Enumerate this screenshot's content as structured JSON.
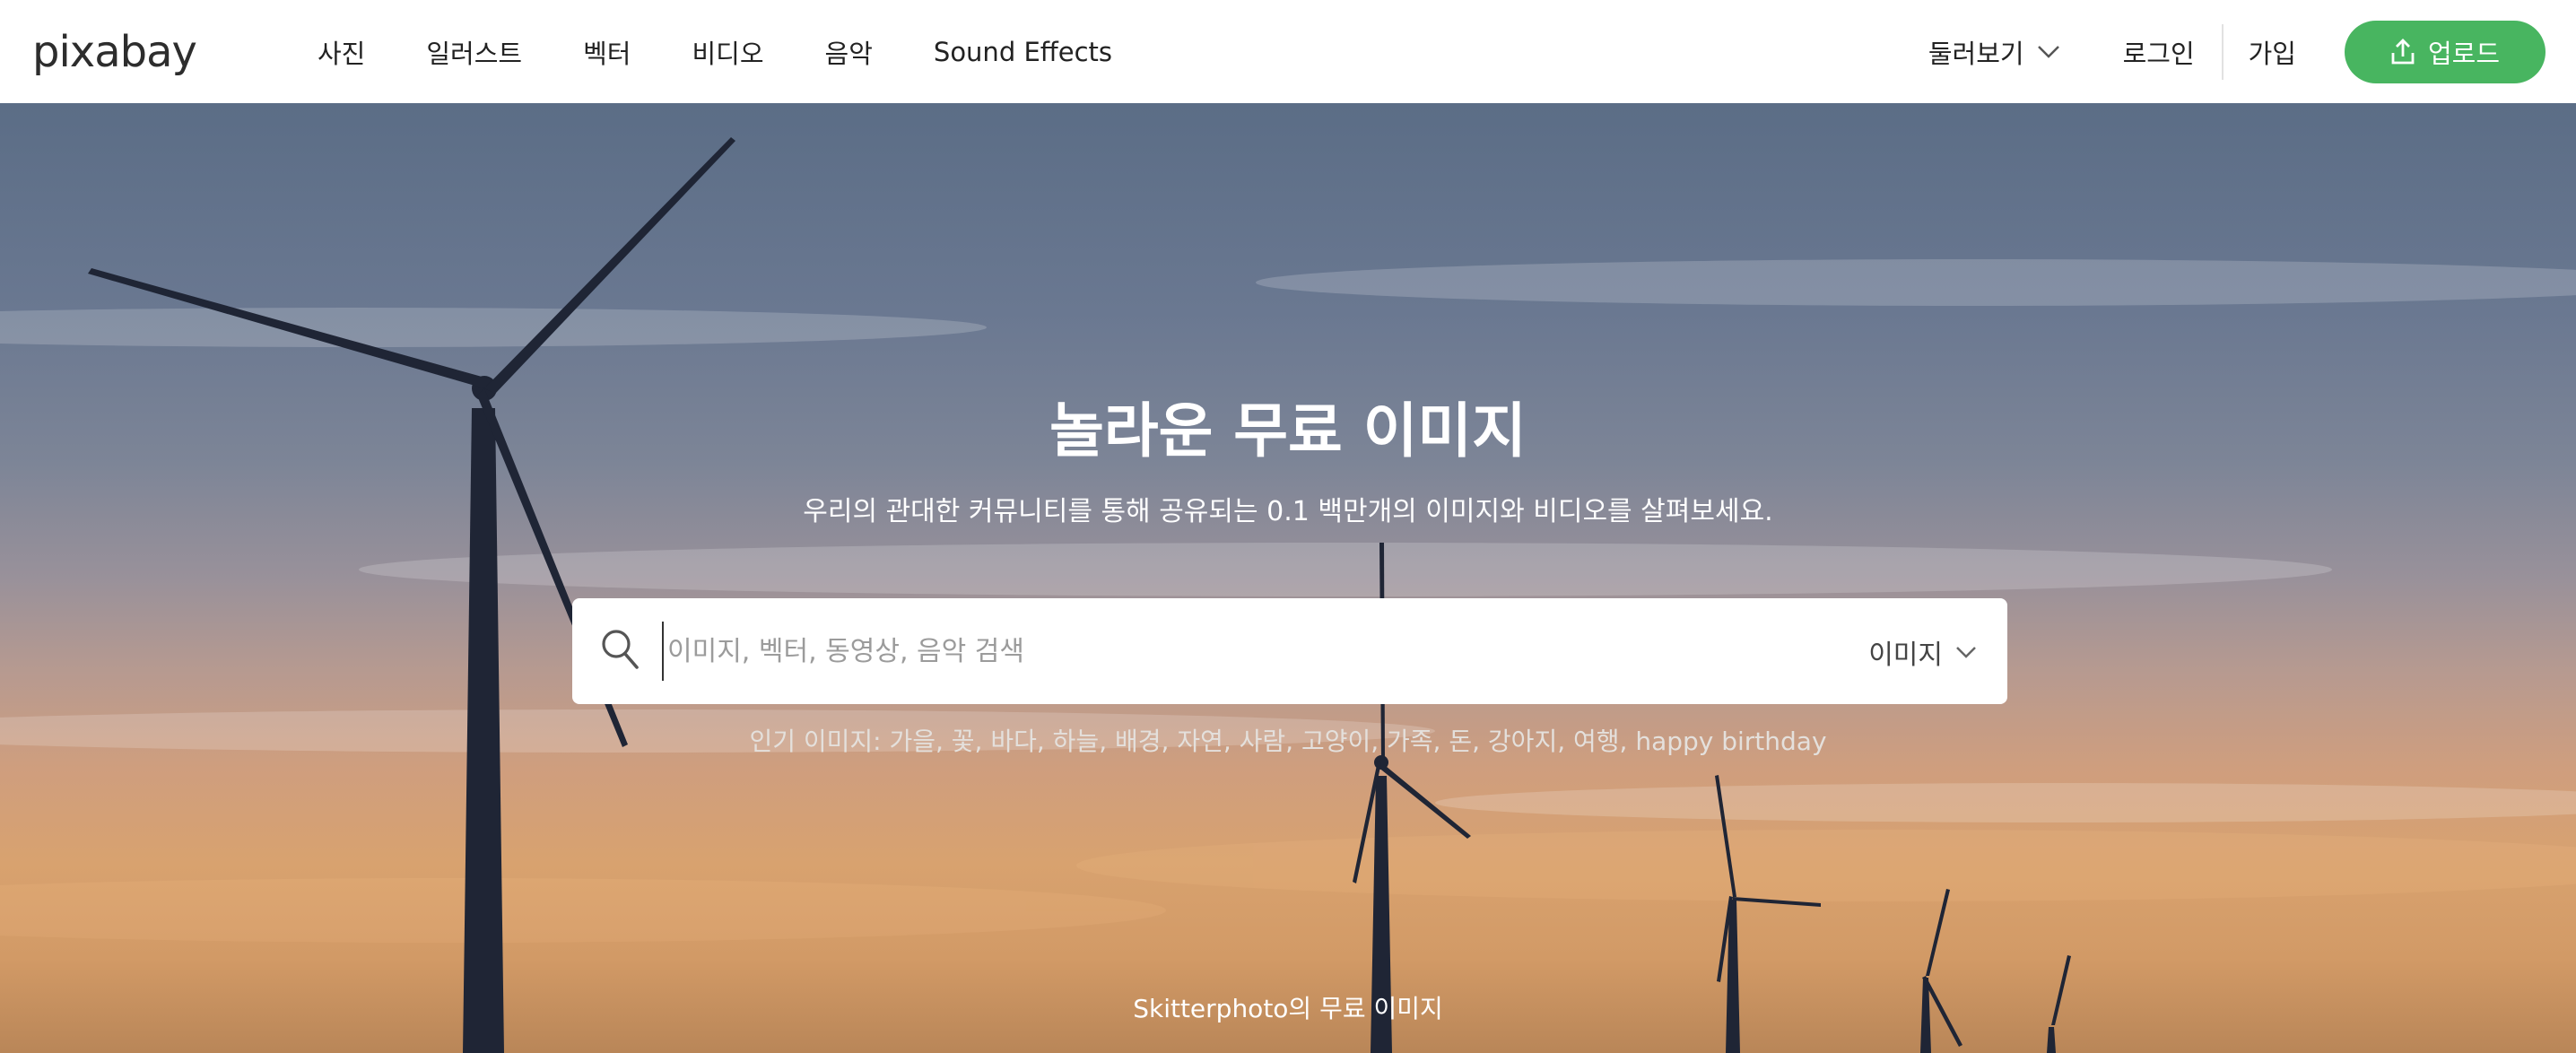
{
  "header": {
    "logo": "pixabay",
    "nav": [
      "사진",
      "일러스트",
      "벡터",
      "비디오",
      "음악",
      "Sound Effects"
    ],
    "explore_label": "둘러보기",
    "login_label": "로그인",
    "signup_label": "가입",
    "upload_label": "업로드"
  },
  "hero": {
    "title": "놀라운 무료 이미지",
    "subtitle": "우리의 관대한 커뮤니티를 통해 공유되는 0.1 백만개의 이미지와 비디오를 살펴보세요.",
    "search": {
      "placeholder": "이미지, 벡터, 동영상, 음악 검색",
      "value": "",
      "type_selected": "이미지"
    },
    "popular": "인기 이미지: 가을, 꽃, 바다, 하늘, 배경, 자연, 사람, 고양이, 가족, 돈, 강아지, 여행, happy birthday",
    "credit": "Skitterphoto의 무료 이미지"
  },
  "colors": {
    "accent": "#48b560",
    "text": "#222222"
  },
  "icons": {
    "search": "search-icon",
    "chevron": "chevron-down-icon",
    "upload": "upload-icon"
  }
}
